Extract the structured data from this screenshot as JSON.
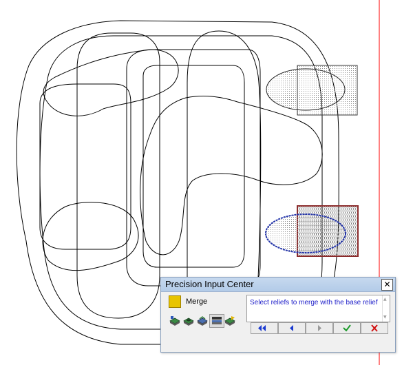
{
  "window": {
    "title": "Precision Input Center",
    "close_glyph": "✕",
    "mode_label": "Merge",
    "mode_color": "#e8c400",
    "message": "Select reliefs to merge with the base relief",
    "scroll_up": "▲",
    "scroll_down": "▼",
    "tools": [
      {
        "name": "merge-add-icon"
      },
      {
        "name": "merge-subtract-icon"
      },
      {
        "name": "merge-highest-icon"
      },
      {
        "name": "merge-lowest-icon"
      },
      {
        "name": "merge-multiply-icon"
      }
    ],
    "nav": [
      {
        "name": "first-button",
        "icon": "double-left-arrow-icon"
      },
      {
        "name": "previous-button",
        "icon": "left-arrow-icon"
      },
      {
        "name": "next-button",
        "icon": "right-arrow-icon"
      },
      {
        "name": "apply-button",
        "icon": "green-check-icon"
      },
      {
        "name": "cancel-button",
        "icon": "red-x-icon"
      }
    ]
  },
  "colors": {
    "selection_outline": "#2233aa",
    "selection_box": "#8b2b2b",
    "boundary_line": "#ff0000",
    "canvas_lines": "#000000"
  }
}
